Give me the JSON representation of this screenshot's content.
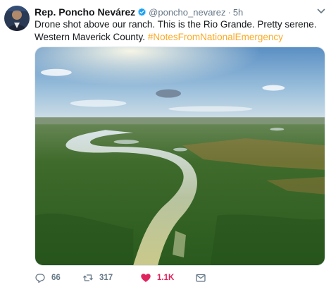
{
  "tweet": {
    "author_name": "Rep. Poncho Nevárez",
    "handle": "@poncho_nevarez",
    "separator": "·",
    "time": "5h",
    "text_main": "Drone shot above our ranch. This is the Rio Grande. Pretty serene. Western Maverick County. ",
    "hashtag": "#NotesFromNationalEmergency",
    "media_alt": "Drone shot of the Rio Grande winding through green brushland"
  },
  "actions": {
    "reply_count": "66",
    "retweet_count": "317",
    "like_count": "1.1K"
  },
  "colors": {
    "hashtag": "#fbaa26",
    "like_active": "#e0245e",
    "verified": "#1da1f2",
    "secondary_text": "#657786"
  },
  "icons": {
    "verified": "verified-badge-icon",
    "caret": "chevron-down-icon",
    "reply": "reply-icon",
    "retweet": "retweet-icon",
    "like": "heart-icon",
    "dm": "direct-message-icon"
  }
}
